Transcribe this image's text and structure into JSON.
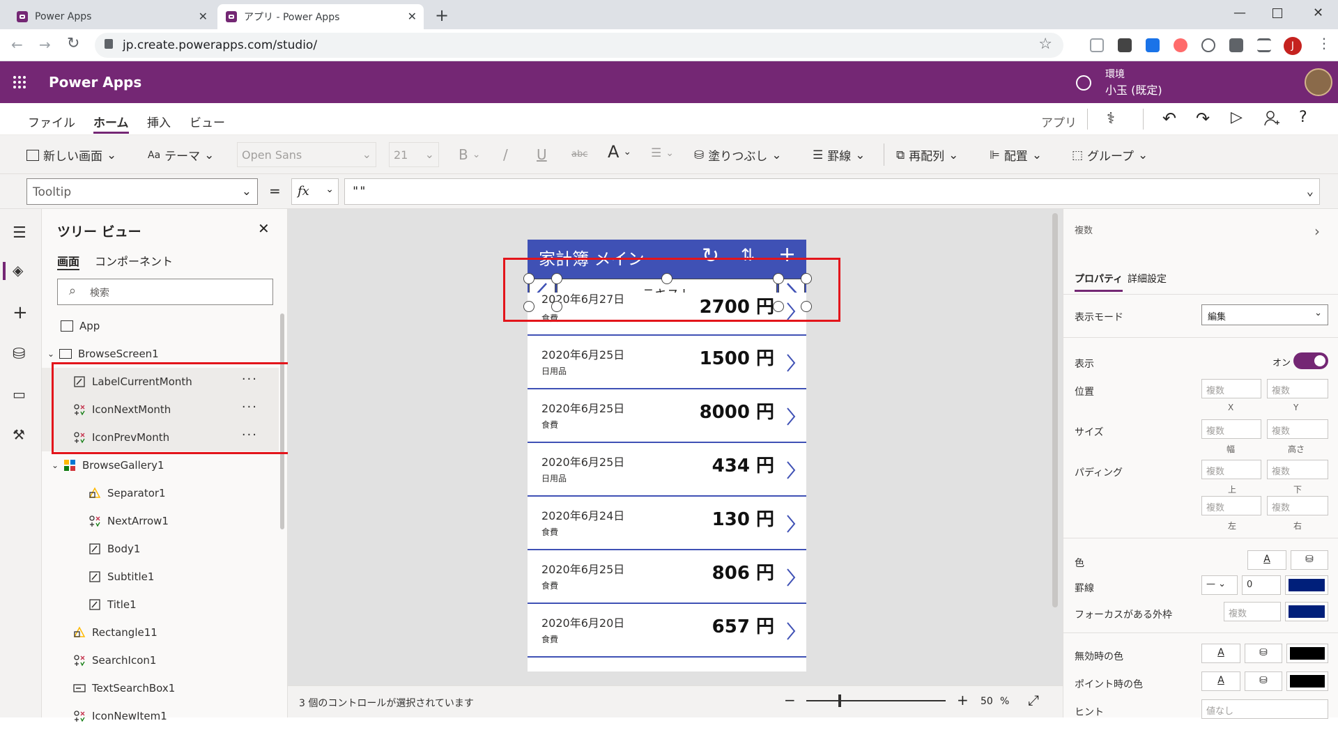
{
  "browser": {
    "tabs": [
      {
        "title": "Power Apps",
        "active": false
      },
      {
        "title": "アプリ - Power Apps",
        "active": true
      }
    ],
    "url": "jp.create.powerapps.com/studio/",
    "profile_initial": "J"
  },
  "app_header": {
    "title": "Power Apps",
    "env_label": "環境",
    "env_name": "小玉 (既定)",
    "brand_color": "#742774"
  },
  "menu": {
    "items": [
      "ファイル",
      "ホーム",
      "挿入",
      "ビュー"
    ],
    "active": "ホーム",
    "app_label": "アプリ"
  },
  "toolbar": {
    "new_screen": "新しい画面",
    "theme": "テーマ",
    "font": "Open Sans",
    "font_size": "21",
    "bold": "B",
    "italic": "/",
    "underline": "U",
    "strike": "abc",
    "fill": "塗りつぶし",
    "border": "罫線",
    "reorder": "再配列",
    "align": "配置",
    "group": "グループ"
  },
  "formula": {
    "property": "Tooltip",
    "equals": "=",
    "fx": "fx",
    "value": "\"\""
  },
  "tree": {
    "title": "ツリー ビュー",
    "tabs": [
      "画面",
      "コンポーネント"
    ],
    "search_placeholder": "検索",
    "app": "App",
    "screen": "BrowseScreen1",
    "items": [
      {
        "label": "LabelCurrentMonth",
        "icon": "label-icon",
        "selected": true
      },
      {
        "label": "IconNextMonth",
        "icon": "icon-control-icon",
        "selected": true
      },
      {
        "label": "IconPrevMonth",
        "icon": "icon-control-icon",
        "selected": true
      },
      {
        "label": "BrowseGallery1",
        "icon": "gallery-icon",
        "selected": false
      },
      {
        "label": "Separator1",
        "icon": "shape-icon",
        "selected": false
      },
      {
        "label": "NextArrow1",
        "icon": "icon-control-icon",
        "selected": false
      },
      {
        "label": "Body1",
        "icon": "label-icon",
        "selected": false
      },
      {
        "label": "Subtitle1",
        "icon": "label-icon",
        "selected": false
      },
      {
        "label": "Title1",
        "icon": "label-icon",
        "selected": false
      },
      {
        "label": "Rectangle11",
        "icon": "shape-icon",
        "selected": false
      },
      {
        "label": "SearchIcon1",
        "icon": "icon-control-icon",
        "selected": false
      },
      {
        "label": "TextSearchBox1",
        "icon": "textinput-icon",
        "selected": false
      },
      {
        "label": "IconNewItem1",
        "icon": "icon-control-icon",
        "selected": false
      }
    ]
  },
  "phone": {
    "header_title": "家計簿 メイン",
    "month_label": "テキスト",
    "header_color": "#3f51b5",
    "rows": [
      {
        "date": "2020年6月27日",
        "category": "食費",
        "amount": "2700 円"
      },
      {
        "date": "2020年6月25日",
        "category": "日用品",
        "amount": "1500 円"
      },
      {
        "date": "2020年6月25日",
        "category": "食費",
        "amount": "8000 円"
      },
      {
        "date": "2020年6月25日",
        "category": "日用品",
        "amount": "434 円"
      },
      {
        "date": "2020年6月24日",
        "category": "食費",
        "amount": "130 円"
      },
      {
        "date": "2020年6月25日",
        "category": "食費",
        "amount": "806 円"
      },
      {
        "date": "2020年6月20日",
        "category": "食費",
        "amount": "657 円"
      }
    ]
  },
  "status": {
    "selection_text": "3 個のコントロールが選択されています",
    "zoom": "50",
    "zoom_unit": "%",
    "minus": "−",
    "plus": "+"
  },
  "props": {
    "header": "複数",
    "tabs": [
      "プロパティ",
      "詳細設定"
    ],
    "display_mode_label": "表示モード",
    "display_mode_value": "編集",
    "visible_label": "表示",
    "visible_value": "オン",
    "position_label": "位置",
    "size_label": "サイズ",
    "padding_label": "パディング",
    "placeholder": "複数",
    "sub_x": "X",
    "sub_y": "Y",
    "sub_w": "幅",
    "sub_h": "高さ",
    "sub_top": "上",
    "sub_bottom": "下",
    "sub_left": "左",
    "sub_right": "右",
    "color_label": "色",
    "border_label": "罫線",
    "border_width": "0",
    "focus_border_label": "フォーカスがある外枠",
    "disabled_color_label": "無効時の色",
    "hover_color_label": "ポイント時の色",
    "hint_label": "ヒント",
    "hint_placeholder": "値なし",
    "font_glyph": "A",
    "accent": "#742774",
    "border_color": "#001f7a"
  }
}
